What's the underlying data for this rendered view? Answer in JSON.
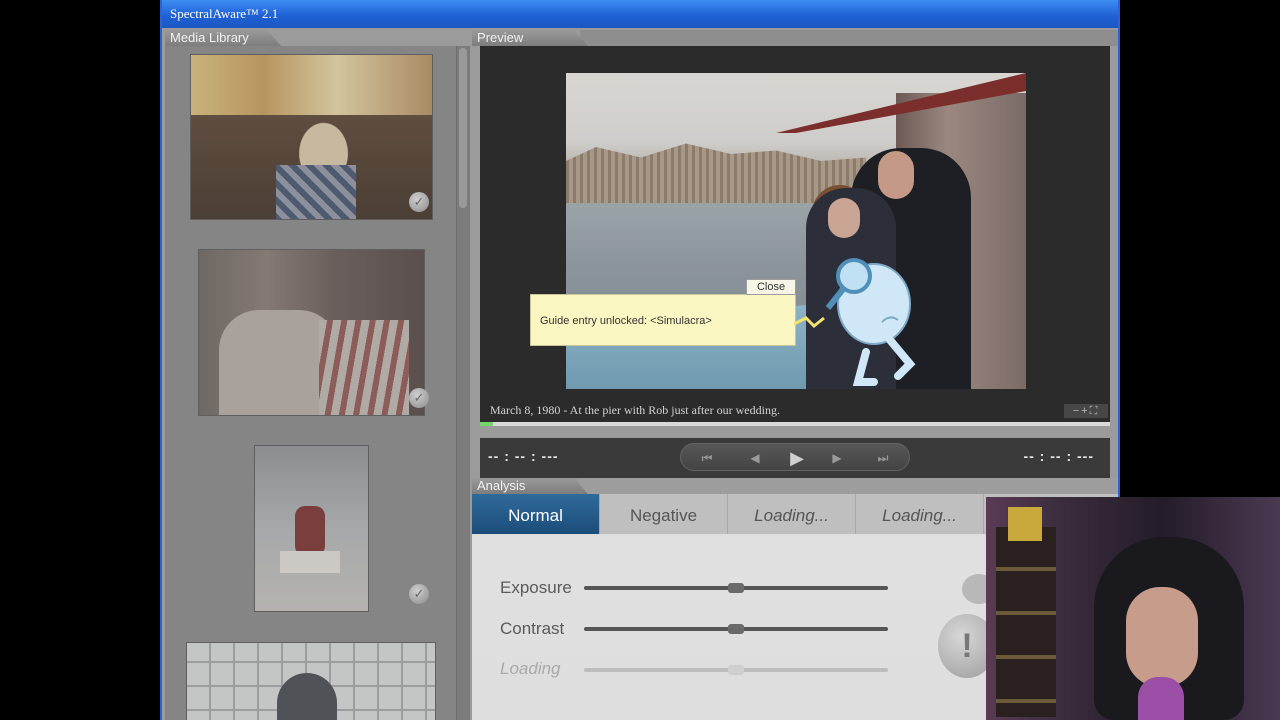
{
  "window": {
    "title": "SpectralAware™ 2.1"
  },
  "media_library": {
    "title": "Media Library",
    "items": [
      {
        "name": "photo-1",
        "checked": true
      },
      {
        "name": "photo-2",
        "checked": true
      },
      {
        "name": "photo-3",
        "checked": true
      },
      {
        "name": "photo-4",
        "checked": false
      }
    ],
    "check_glyph": "✓"
  },
  "preview": {
    "title": "Preview",
    "caption": "March 8, 1980 - At the pier with Rob just after our wedding.",
    "zoom_controls": "−+⛶",
    "progress_percent": 2
  },
  "popup": {
    "message": "Guide entry unlocked: <Simulacra>",
    "close_label": "Close"
  },
  "transport": {
    "time_left": "-- : -- : ---",
    "time_right": "-- : -- : ---",
    "icons": {
      "rewind": "⏮",
      "step_back": "◀",
      "play": "▶",
      "step_forward": "▶",
      "fast_forward": "⏭"
    }
  },
  "analysis": {
    "title": "Analysis",
    "tabs": [
      {
        "label": "Normal",
        "active": true
      },
      {
        "label": "Negative",
        "active": false
      },
      {
        "label": "Loading...",
        "active": false
      },
      {
        "label": "Loading...",
        "active": false
      }
    ],
    "sliders": [
      {
        "label": "Exposure",
        "value": 0.5
      },
      {
        "label": "Contrast",
        "value": 0.5
      },
      {
        "label": "Loading",
        "value": 0.5
      }
    ],
    "warning_glyph": "!"
  },
  "colors": {
    "titlebar": "#1d5fd2",
    "active_tab": "#1c4d7a",
    "popup_bg": "#fbf7c2",
    "progress": "#79d36d"
  }
}
